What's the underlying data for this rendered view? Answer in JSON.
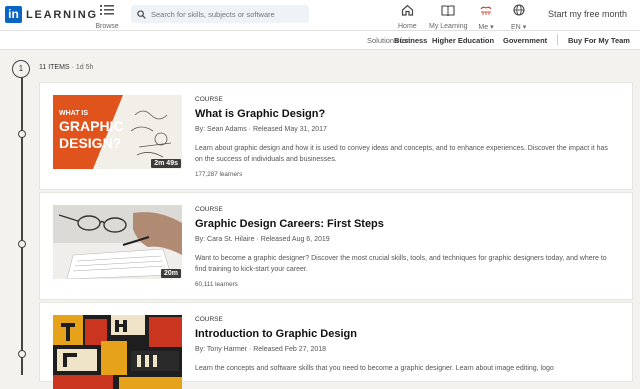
{
  "nav": {
    "logo_box": "in",
    "logo_word": "LEARNING",
    "browse_label": "Browse",
    "search_placeholder": "Search for skills, subjects or software",
    "home_label": "Home",
    "my_learning_label": "My Learning",
    "me_label": "Me",
    "lang_label": "EN",
    "start_label": "Start my free month"
  },
  "subnav": {
    "solutions_for": "Solutions for:",
    "business": "Business",
    "higher_education": "Higher Education",
    "government": "Government",
    "buy_for_team": "Buy For My Team"
  },
  "path": {
    "step": "1",
    "items_count": "11 ITEMS",
    "duration": "1d 5h"
  },
  "courses": [
    {
      "type": "COURSE",
      "title": "What is Graphic Design?",
      "author": "By: Sean Adams",
      "released": "Released May 31, 2017",
      "description": "Learn about graphic design and how it is used to convey ideas and concepts, and to enhance experiences. Discover the impact it has on the success of individuals and businesses.",
      "learners": "177,287 learners",
      "duration": "2m 49s",
      "thumb_text_1": "WHAT IS",
      "thumb_text_2": "GRAPHIC",
      "thumb_text_3": "DESIGN?"
    },
    {
      "type": "COURSE",
      "title": "Graphic Design Careers: First Steps",
      "author": "By: Cara St. Hilaire",
      "released": "Released Aug 6, 2019",
      "description": "Want to become a graphic designer? Discover the most crucial skills, tools, and techniques for graphic designers today, and where to find training to kick-start your career.",
      "learners": "60,111 learners",
      "duration": "20m"
    },
    {
      "type": "COURSE",
      "title": "Introduction to Graphic Design",
      "author": "By: Tony Harmer",
      "released": "Released Feb 27, 2018",
      "description": "Learn the concepts and software skills that you need to become a graphic designer. Learn about image editing, logo",
      "learners": ""
    }
  ],
  "colors": {
    "brand_blue": "#0a66c2",
    "accent_orange": "#e0531c"
  }
}
